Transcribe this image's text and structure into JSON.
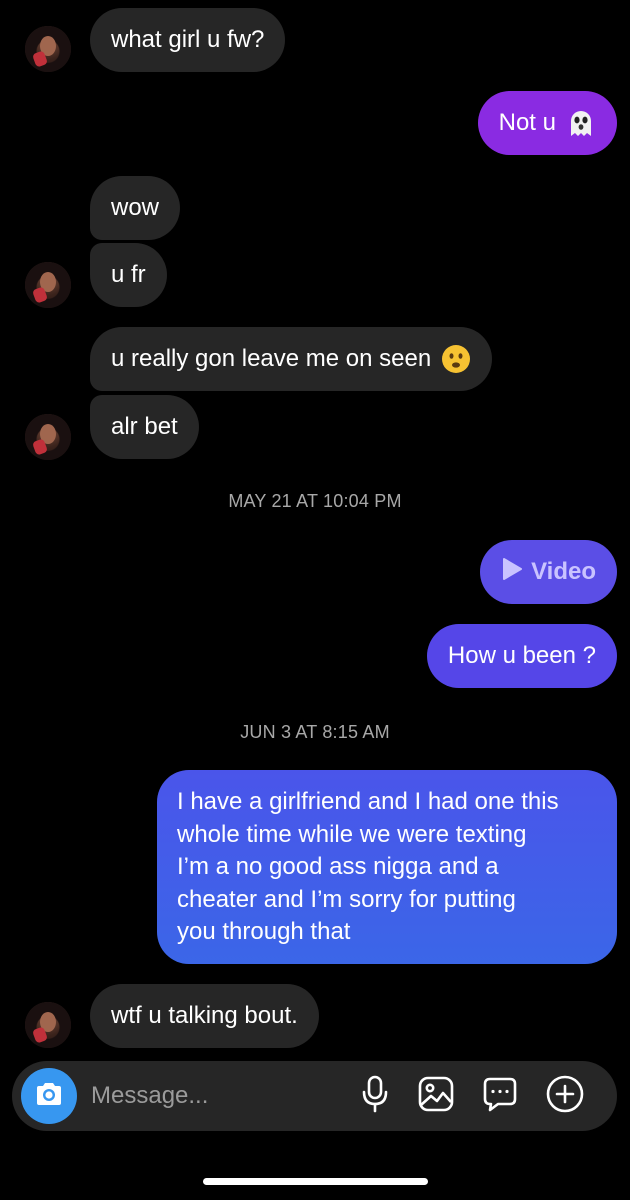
{
  "conversation": {
    "messages": [
      {
        "id": "m1",
        "sender": "them",
        "text": "what girl u fw?"
      },
      {
        "id": "m2",
        "sender": "me",
        "text": "Not u",
        "emoji": "ghost-emoji"
      },
      {
        "id": "m3",
        "sender": "them",
        "text": "wow"
      },
      {
        "id": "m4",
        "sender": "them",
        "text": "u fr"
      },
      {
        "id": "m5",
        "sender": "them",
        "text": "u really gon leave me on seen",
        "emoji": "frowning-face-emoji"
      },
      {
        "id": "m6",
        "sender": "them",
        "text": "alr bet"
      },
      {
        "id": "m7",
        "sender": "me",
        "type": "video",
        "text": "Video"
      },
      {
        "id": "m8",
        "sender": "me",
        "text": "How u been ?"
      },
      {
        "id": "m9",
        "sender": "me",
        "lines": [
          "I have a girlfriend and I had one this",
          "whole time while we were texting",
          "I’m a no good ass nigga and a",
          "cheater and I’m sorry for putting",
          "you through that"
        ]
      },
      {
        "id": "m10",
        "sender": "them",
        "text": "wtf u talking bout."
      }
    ],
    "timestamps": {
      "t1": "MAY 21 AT 10:04 PM",
      "t2": "JUN 3 AT 8:15 AM"
    }
  },
  "composer": {
    "placeholder": "Message...",
    "icons": [
      "camera-icon",
      "microphone-icon",
      "gallery-icon",
      "sticker-chat-icon",
      "add-icon"
    ]
  },
  "colors": {
    "incoming_bubble": "#262626",
    "outgoing_purple": "#8a2be2",
    "outgoing_indigo": "#5b4ee6",
    "outgoing_blue": "#3b63e8",
    "camera_button": "#3797f0",
    "timestamp": "#a8a8a8"
  }
}
